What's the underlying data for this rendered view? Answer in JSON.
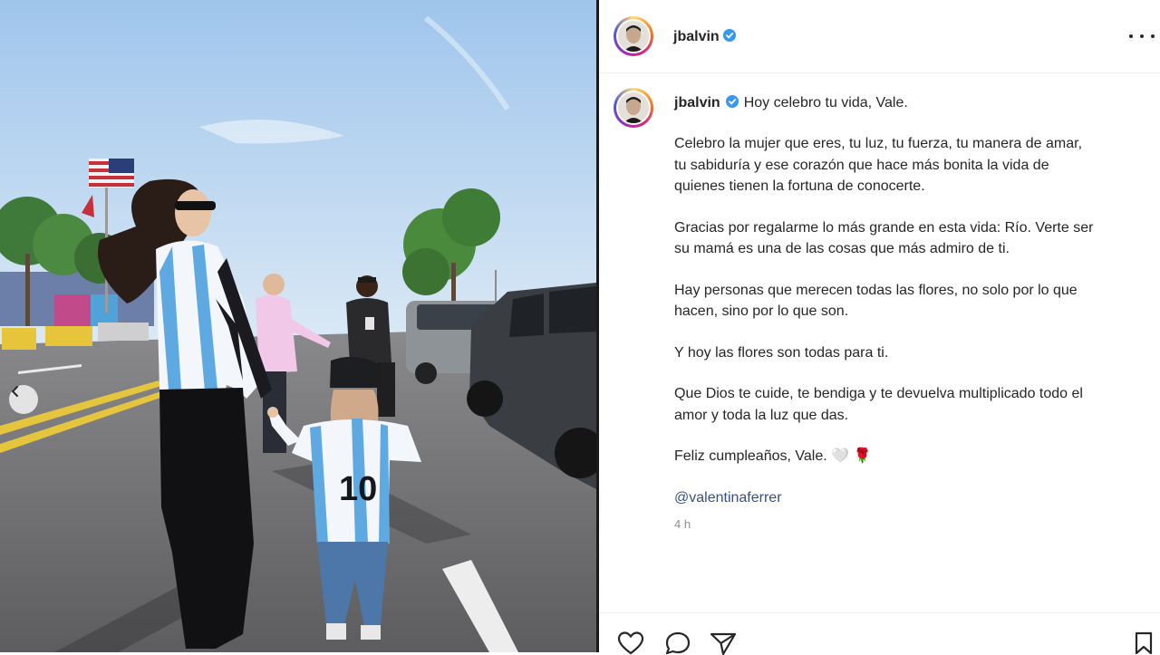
{
  "post": {
    "username": "jbalvin",
    "verified": true,
    "caption": {
      "first_line": "Hoy celebro tu vida, Vale.",
      "paragraphs": [
        [
          "Celebro la mujer que eres, tu luz, tu fuerza, tu manera de amar,",
          "tu sabiduría y ese corazón que hace más bonita la vida de",
          "quienes tienen la fortuna de conocerte."
        ],
        [
          "Gracias por regalarme lo más grande en esta vida: Río. Verte ser",
          "su mamá es una de las cosas que más admiro de ti."
        ],
        [
          "Hay personas que merecen todas las flores, no solo por lo que",
          "hacen, sino por lo que son."
        ],
        [
          "Y hoy las flores son todas para ti."
        ],
        [
          "Que Dios te cuide, te bendiga y te devuelva multiplicado todo el",
          "amor y toda la luz que das."
        ]
      ],
      "closing": "Feliz cumpleaños, Vale. 🤍 🌹",
      "mention": "@valentinaferrer"
    },
    "timestamp": "4 h",
    "jersey_number": "10"
  },
  "icons": {
    "verified": "verified-badge-icon",
    "more": "more-options-icon",
    "prev": "chevron-left-icon",
    "like": "heart-icon",
    "comment": "comment-icon",
    "share": "send-icon",
    "save": "bookmark-icon"
  },
  "colors": {
    "verified": "#3897f0",
    "text": "#262626",
    "muted": "#8e8e8e",
    "sky": "#b9d6f2"
  }
}
